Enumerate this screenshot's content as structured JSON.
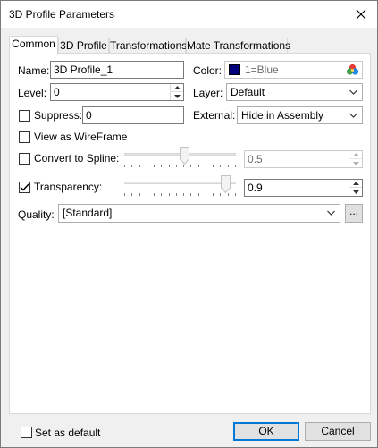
{
  "window": {
    "title": "3D Profile Parameters"
  },
  "tabs": [
    {
      "label": "Common"
    },
    {
      "label": "3D Profile"
    },
    {
      "label": "Transformations"
    },
    {
      "label": "Mate Transformations"
    }
  ],
  "form": {
    "name_label": "Name:",
    "name_value": "3D Profile_1",
    "color_label": "Color:",
    "color_value": "1=Blue",
    "color_swatch": "#00007f",
    "level_label": "Level:",
    "level_value": "0",
    "layer_label": "Layer:",
    "layer_value": "Default",
    "suppress_label": "Suppress:",
    "suppress_value": "0",
    "external_label": "External:",
    "external_value": "Hide in Assembly",
    "wireframe_label": "View as WireFrame",
    "spline_label": "Convert to Spline:",
    "spline_value": "0.5",
    "spline_slider_fraction": 0.5,
    "transparency_label": "Transparency:",
    "transparency_value": "0.9",
    "transparency_slider_fraction": 0.9,
    "quality_label": "Quality:",
    "quality_value": "[Standard]",
    "quality_more": "..."
  },
  "checks": {
    "suppress": false,
    "wireframe": false,
    "spline": false,
    "transparency": true,
    "set_default": false
  },
  "footer": {
    "set_default_label": "Set as default",
    "ok_label": "OK",
    "cancel_label": "Cancel"
  },
  "icons": {
    "close": "close-icon",
    "palette": "palette-icon",
    "check": "checkmark-icon",
    "dropdown": "chevron-down-icon"
  }
}
